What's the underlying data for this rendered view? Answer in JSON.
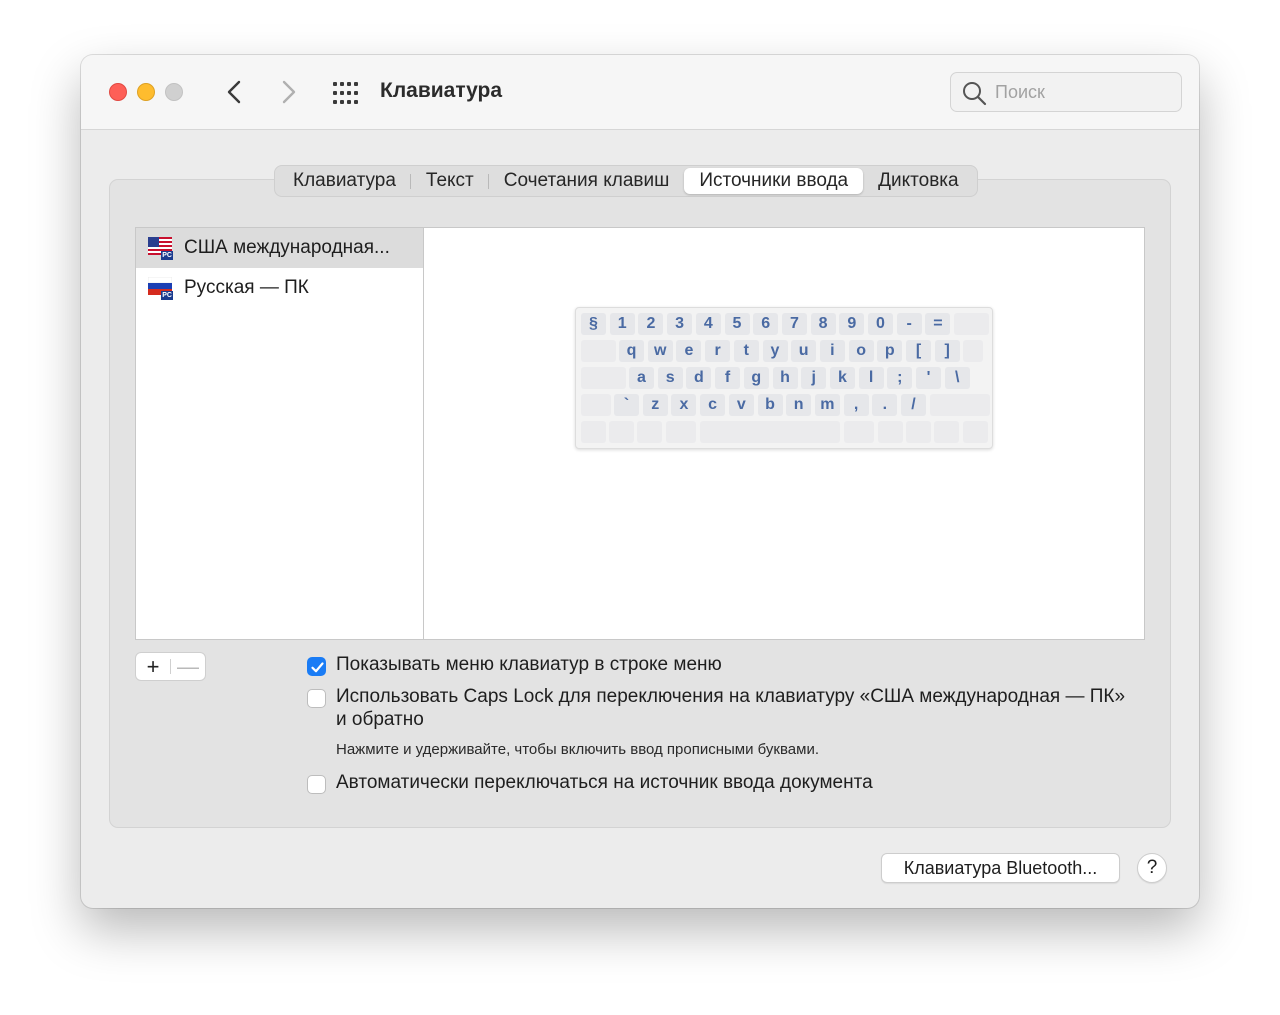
{
  "window": {
    "title": "Клавиатура",
    "search_placeholder": "Поиск"
  },
  "tabs": [
    {
      "label": "Клавиатура",
      "active": false
    },
    {
      "label": "Текст",
      "active": false
    },
    {
      "label": "Сочетания клавиш",
      "active": false
    },
    {
      "label": "Источники ввода",
      "active": true
    },
    {
      "label": "Диктовка",
      "active": false
    }
  ],
  "input_sources": [
    {
      "label": "США международная...",
      "flag": "us-flag-icon",
      "badge": "PC",
      "selected": true
    },
    {
      "label": "Русская — ПК",
      "flag": "ru-flag-icon",
      "badge": "PC",
      "selected": false
    }
  ],
  "keyboard_preview": {
    "row1": [
      "§",
      "1",
      "2",
      "3",
      "4",
      "5",
      "6",
      "7",
      "8",
      "9",
      "0",
      "-",
      "="
    ],
    "row2": [
      "q",
      "w",
      "e",
      "r",
      "t",
      "y",
      "u",
      "i",
      "o",
      "p",
      "[",
      "]"
    ],
    "row3": [
      "a",
      "s",
      "d",
      "f",
      "g",
      "h",
      "j",
      "k",
      "l",
      ";",
      "'",
      "\\"
    ],
    "row4": [
      "`",
      "z",
      "x",
      "c",
      "v",
      "b",
      "n",
      "m",
      ",",
      ".",
      "/"
    ]
  },
  "list_controls": {
    "add": "+",
    "remove": "—"
  },
  "options": [
    {
      "label": "Показывать меню клавиатур в строке меню",
      "checked": true
    },
    {
      "label": "Использовать Caps Lock для переключения на клавиатуру «США международная — ПК»",
      "label_line2": "и обратно",
      "checked": false
    },
    {
      "label": "Автоматически переключаться на источник ввода документа",
      "checked": false
    }
  ],
  "hint": "Нажмите и удерживайте, чтобы включить ввод прописными буквами.",
  "buttons": {
    "bluetooth": "Клавиатура Bluetooth...",
    "help": "?"
  },
  "colors": {
    "accent": "#1a7cf5",
    "key_text": "#4a6aa3",
    "close": "#fe5f57",
    "minimize": "#febc2e"
  }
}
